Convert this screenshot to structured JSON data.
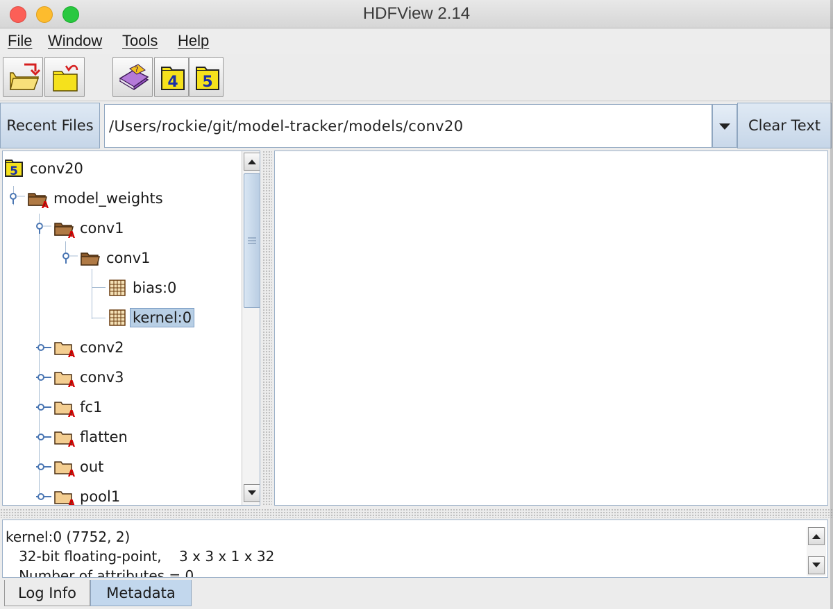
{
  "window": {
    "title": "HDFView 2.14"
  },
  "menu": {
    "items": [
      {
        "label": "File"
      },
      {
        "label": "Window"
      },
      {
        "label": "Tools"
      },
      {
        "label": "Help"
      }
    ]
  },
  "toolbar": {
    "buttons": [
      {
        "icon": "open-file-icon"
      },
      {
        "icon": "open-folder-icon"
      },
      {
        "icon": "help-book-icon"
      },
      {
        "icon": "hdf4-icon",
        "badge": "4"
      },
      {
        "icon": "hdf5-icon",
        "badge": "5"
      }
    ]
  },
  "recent": {
    "button_label": "Recent Files",
    "path_value": "/Users/rockie/git/model-tracker/models/conv20",
    "clear_label": "Clear Text"
  },
  "tree": {
    "root": {
      "label": "conv20",
      "badge": "5"
    },
    "nodes": [
      {
        "label": "model_weights",
        "type": "group-attr",
        "expanded": true
      },
      {
        "label": "conv1",
        "type": "group-attr",
        "expanded": true
      },
      {
        "label": "conv1",
        "type": "group",
        "expanded": true
      },
      {
        "label": "bias:0",
        "type": "dataset"
      },
      {
        "label": "kernel:0",
        "type": "dataset",
        "selected": true
      },
      {
        "label": "conv2",
        "type": "group-attr",
        "expanded": false
      },
      {
        "label": "conv3",
        "type": "group-attr",
        "expanded": false
      },
      {
        "label": "fc1",
        "type": "group-attr",
        "expanded": false
      },
      {
        "label": "flatten",
        "type": "group-attr",
        "expanded": false
      },
      {
        "label": "out",
        "type": "group-attr",
        "expanded": false
      },
      {
        "label": "pool1",
        "type": "group-attr",
        "expanded": false
      }
    ]
  },
  "info": {
    "line1": "kernel:0 (7752, 2)",
    "line2": "   32-bit floating-point,    3 x 3 x 1 x 32",
    "line3": "   Number of attributes = 0"
  },
  "tabs": [
    {
      "label": "Log Info"
    },
    {
      "label": "Metadata",
      "selected": true
    }
  ],
  "colors": {
    "selection": "#b8cfe5",
    "tab_selected": "#c2d7ed",
    "folder": "#8b5a2b",
    "attr_badge": "#d10000"
  }
}
